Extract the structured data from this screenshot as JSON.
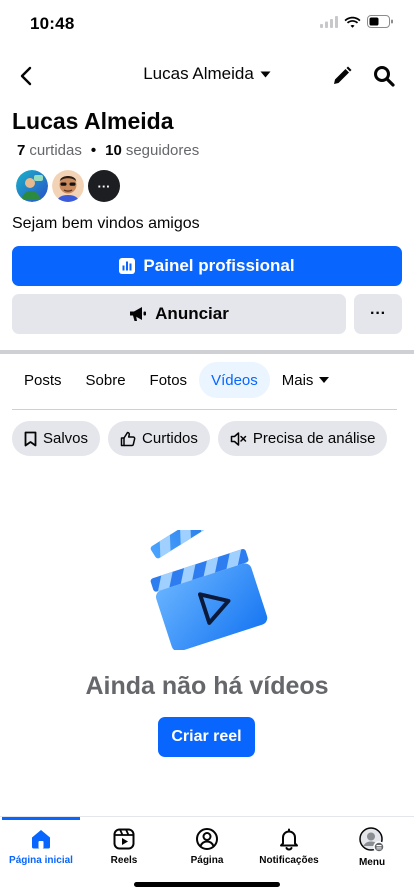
{
  "status_bar": {
    "time": "10:48"
  },
  "header": {
    "title": "Lucas Almeida"
  },
  "profile": {
    "name": "Lucas Almeida",
    "likes_count": "7",
    "likes_label": "curtidas",
    "followers_count": "10",
    "followers_label": "seguidores",
    "friends_more": "···",
    "bio": "Sejam bem vindos amigos"
  },
  "actions": {
    "professional_panel": "Painel profissional",
    "advertise": "Anunciar",
    "more": "···"
  },
  "tabs": [
    {
      "label": "Posts"
    },
    {
      "label": "Sobre"
    },
    {
      "label": "Fotos"
    },
    {
      "label": "Vídeos",
      "active": true
    },
    {
      "label": "Mais"
    }
  ],
  "filters": [
    {
      "label": "Salvos",
      "icon": "bookmark-icon"
    },
    {
      "label": "Curtidos",
      "icon": "thumbs-up-icon"
    },
    {
      "label": "Precisa de análise",
      "icon": "muted-speaker-icon"
    }
  ],
  "empty_state": {
    "title": "Ainda não há vídeos",
    "button": "Criar reel",
    "icon": "clapperboard-icon"
  },
  "bottom_nav": [
    {
      "label": "Página inicial",
      "icon": "home-icon",
      "active": true
    },
    {
      "label": "Reels",
      "icon": "reels-icon"
    },
    {
      "label": "Página",
      "icon": "page-profile-icon"
    },
    {
      "label": "Notificações",
      "icon": "bell-icon"
    },
    {
      "label": "Menu",
      "icon": "menu-avatar-icon"
    }
  ],
  "colors": {
    "accent": "#0866ff",
    "button_secondary": "#e4e6eb",
    "text_secondary": "#65676b"
  }
}
